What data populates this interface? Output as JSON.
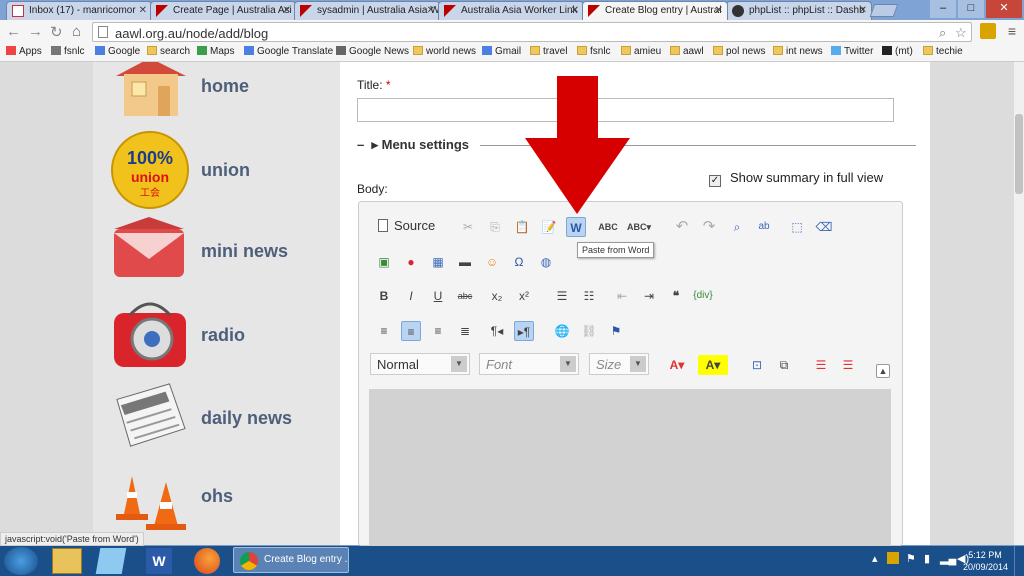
{
  "tabs": [
    {
      "label": "Inbox (17) - manricomor",
      "icon": "gmail-icon",
      "active": false
    },
    {
      "label": "Create Page | Australia Asi",
      "icon": "aawl-icon",
      "active": false
    },
    {
      "label": "sysadmin | Australia Asia W",
      "icon": "aawl-icon",
      "active": false
    },
    {
      "label": "Australia Asia Worker Link",
      "icon": "aawl-icon",
      "active": false
    },
    {
      "label": "Create Blog entry | Austral",
      "icon": "aawl-icon",
      "active": true
    },
    {
      "label": "phpList :: phpList :: Dashb",
      "icon": "phplist-icon",
      "active": false
    }
  ],
  "address": {
    "url": "aawl.org.au/node/add/blog"
  },
  "bookmarks": [
    "Apps",
    "fsnlc",
    "Google",
    "search",
    "Maps",
    "Google Translate",
    "Google News",
    "world news",
    "Gmail",
    "travel",
    "fsnlc",
    "amieu",
    "aawl",
    "pol news",
    "int news",
    "Twitter",
    "(mt)",
    "techie"
  ],
  "sidebar": {
    "items": [
      {
        "label": "home",
        "icon": "house-icon"
      },
      {
        "label": "union",
        "icon": "union-badge-icon",
        "badge_text": "100% union 工会"
      },
      {
        "label": "mini news",
        "icon": "envelope-icon"
      },
      {
        "label": "radio",
        "icon": "radio-icon"
      },
      {
        "label": "daily news",
        "icon": "newspaper-icon"
      },
      {
        "label": "ohs",
        "icon": "traffic-cone-icon"
      }
    ]
  },
  "form": {
    "title_label": "Title:",
    "required_mark": "*",
    "menu_settings": "Menu settings",
    "menu_toggle": "–",
    "body_label": "Body:",
    "summary_label": "Show summary in full view",
    "summary_checked": true
  },
  "editor": {
    "source_label": "Source",
    "format_value": "Normal",
    "font_placeholder": "Font",
    "size_placeholder": "Size",
    "tooltip": "Paste from Word"
  },
  "statusbar": {
    "text": "javascript:void('Paste from Word')"
  },
  "taskbar": {
    "chrome_label": "Create Blog entry ...",
    "time": "5:12 PM",
    "date": "20/09/2014"
  },
  "colors": {
    "arrow": "#d60000",
    "sidebar_label": "#4d5f7a",
    "taskbar": "#1b4f8a"
  }
}
